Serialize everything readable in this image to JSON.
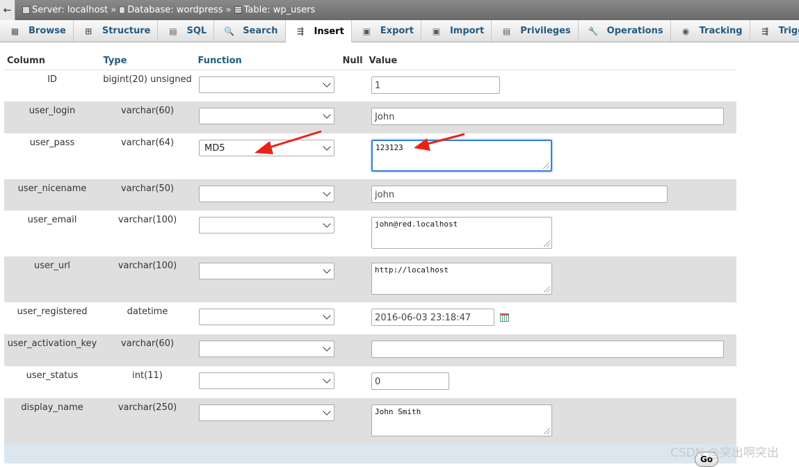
{
  "breadcrumb": {
    "back": "←",
    "server": "Server: localhost",
    "database": "Database: wordpress",
    "table": "Table: wp_users",
    "separator": "»"
  },
  "tabs": [
    {
      "label": "Browse",
      "icon": "browse-icon",
      "glyph": "▦"
    },
    {
      "label": "Structure",
      "icon": "structure-icon",
      "glyph": "⊞"
    },
    {
      "label": "SQL",
      "icon": "sql-icon",
      "glyph": "▤"
    },
    {
      "label": "Search",
      "icon": "search-icon",
      "glyph": "🔍"
    },
    {
      "label": "Insert",
      "icon": "insert-icon",
      "glyph": "⇶"
    },
    {
      "label": "Export",
      "icon": "export-icon",
      "glyph": "▣"
    },
    {
      "label": "Import",
      "icon": "import-icon",
      "glyph": "▣"
    },
    {
      "label": "Privileges",
      "icon": "privileges-icon",
      "glyph": "▤"
    },
    {
      "label": "Operations",
      "icon": "wrench-icon",
      "glyph": "🔧"
    },
    {
      "label": "Tracking",
      "icon": "eye-icon",
      "glyph": "◉"
    },
    {
      "label": "Triggers",
      "icon": "triggers-icon",
      "glyph": "⇶"
    }
  ],
  "active_tab": "Insert",
  "headers": {
    "column": "Column",
    "type": "Type",
    "function": "Function",
    "null": "Null",
    "value": "Value"
  },
  "rows": [
    {
      "column": "ID",
      "type": "bigint(20) unsigned",
      "function": "",
      "value": "1"
    },
    {
      "column": "user_login",
      "type": "varchar(60)",
      "function": "",
      "value": "John"
    },
    {
      "column": "user_pass",
      "type": "varchar(64)",
      "function": "MD5",
      "value": "123123"
    },
    {
      "column": "user_nicename",
      "type": "varchar(50)",
      "function": "",
      "value": "john"
    },
    {
      "column": "user_email",
      "type": "varchar(100)",
      "function": "",
      "value": "john@red.localhost"
    },
    {
      "column": "user_url",
      "type": "varchar(100)",
      "function": "",
      "value": "http://localhost"
    },
    {
      "column": "user_registered",
      "type": "datetime",
      "function": "",
      "value": "2016-06-03 23:18:47"
    },
    {
      "column": "user_activation_key",
      "type": "varchar(60)",
      "function": "",
      "value": ""
    },
    {
      "column": "user_status",
      "type": "int(11)",
      "function": "",
      "value": "0"
    },
    {
      "column": "display_name",
      "type": "varchar(250)",
      "function": "",
      "value": "John Smith"
    }
  ],
  "go_button": "Go",
  "watermark": "CSDN @突出啊突出",
  "colors": {
    "link": "#235a81",
    "row_alt": "#dfdfdf",
    "arrow": "#e8231a",
    "focus": "#3b7fd6"
  }
}
